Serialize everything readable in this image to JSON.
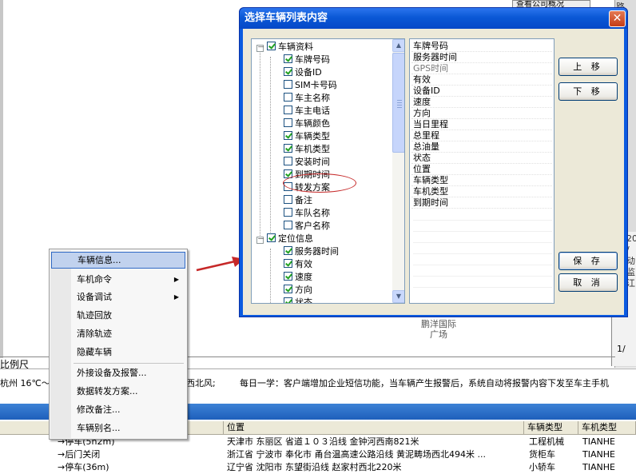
{
  "background": {
    "top_combo": "查看公司概况",
    "right_top": "路",
    "right_panel_text": "20 / 动 监 江",
    "page_label": "1/",
    "map_place": [
      "鹏洋国际",
      "广场"
    ],
    "scale_label": "比例尺",
    "weather": "杭州 16℃～6",
    "weather_end": "西北风;",
    "daily_tip": "每日一学：客户端增加企业短信功能，当车辆产生报警后，系统自动将报警内容下发至车主手机",
    "table": {
      "headers": [
        "",
        "位置",
        "车辆类型",
        "车机类型"
      ],
      "rows": [
        [
          "→停车(5h2m)",
          "天津市 东丽区 省道１０３沿线 金钟河西南821米",
          "工程机械",
          "TIANHE"
        ],
        [
          "→后门关闭",
          "浙江省 宁波市 奉化市 甬台温高速公路沿线 黄泥畴场西北494米 ...",
          "货柜车",
          "TIANHE"
        ],
        [
          "→停车(36m)",
          "辽宁省 沈阳市 东望街沿线 赵家村西北220米",
          "小轿车",
          "TIANHE"
        ]
      ]
    }
  },
  "context_menu": {
    "items": [
      {
        "label": "车辆信息...",
        "selected": true,
        "submenu": false
      },
      {
        "label": "车机命令",
        "submenu": true
      },
      {
        "label": "设备调试",
        "submenu": true
      },
      {
        "label": "轨迹回放",
        "submenu": false
      },
      {
        "label": "清除轨迹",
        "submenu": false
      },
      {
        "label": "隐藏车辆",
        "submenu": false
      },
      {
        "label": "外接设备及报警...",
        "submenu": false
      },
      {
        "label": "数据转发方案...",
        "submenu": false
      },
      {
        "label": "修改备注...",
        "submenu": false
      },
      {
        "label": "车辆别名...",
        "submenu": false
      }
    ],
    "arrow_glyph": "▶"
  },
  "dialog": {
    "title": "选择车辆列表内容",
    "close_glyph": "✕",
    "tree": {
      "group1": {
        "label": "车辆资料",
        "checked": true,
        "toggle": "－"
      },
      "group1_items": [
        {
          "label": "车牌号码",
          "checked": true
        },
        {
          "label": "设备ID",
          "checked": true
        },
        {
          "label": "SIM卡号码",
          "checked": false
        },
        {
          "label": "车主名称",
          "checked": false
        },
        {
          "label": "车主电话",
          "checked": false
        },
        {
          "label": "车辆颜色",
          "checked": false
        },
        {
          "label": "车辆类型",
          "checked": true
        },
        {
          "label": "车机类型",
          "checked": true
        },
        {
          "label": "安装时间",
          "checked": false
        },
        {
          "label": "到期时间",
          "checked": true
        },
        {
          "label": "转发方案",
          "checked": false
        },
        {
          "label": "备注",
          "checked": false
        },
        {
          "label": "车队名称",
          "checked": false
        },
        {
          "label": "客户名称",
          "checked": false
        }
      ],
      "group2": {
        "label": "定位信息",
        "checked": true,
        "toggle": "－"
      },
      "group2_items": [
        {
          "label": "服务器时间",
          "checked": true
        },
        {
          "label": "有效",
          "checked": true
        },
        {
          "label": "速度",
          "checked": true
        },
        {
          "label": "方向",
          "checked": true
        },
        {
          "label": "状态",
          "checked": true
        }
      ],
      "scroll_up": "▲",
      "scroll_down": "▼"
    },
    "selected_columns": [
      {
        "label": "车牌号码",
        "gray": false
      },
      {
        "label": "服务器时间",
        "gray": false
      },
      {
        "label": "GPS时间",
        "gray": true
      },
      {
        "label": "有效",
        "gray": false
      },
      {
        "label": "设备ID",
        "gray": false
      },
      {
        "label": "速度",
        "gray": false
      },
      {
        "label": "方向",
        "gray": false
      },
      {
        "label": "当日里程",
        "gray": false
      },
      {
        "label": "总里程",
        "gray": false
      },
      {
        "label": "总油量",
        "gray": false
      },
      {
        "label": "状态",
        "gray": false
      },
      {
        "label": "位置",
        "gray": false
      },
      {
        "label": "车辆类型",
        "gray": false
      },
      {
        "label": "车机类型",
        "gray": false
      },
      {
        "label": "到期时间",
        "gray": false
      }
    ],
    "buttons": {
      "move_up": "上 移",
      "move_down": "下 移",
      "save": "保 存",
      "cancel": "取 消"
    }
  },
  "colors": {
    "title_bar": "#0a58d6",
    "annotation_red": "#c62828",
    "menu_selected": "#c1d2ee"
  }
}
